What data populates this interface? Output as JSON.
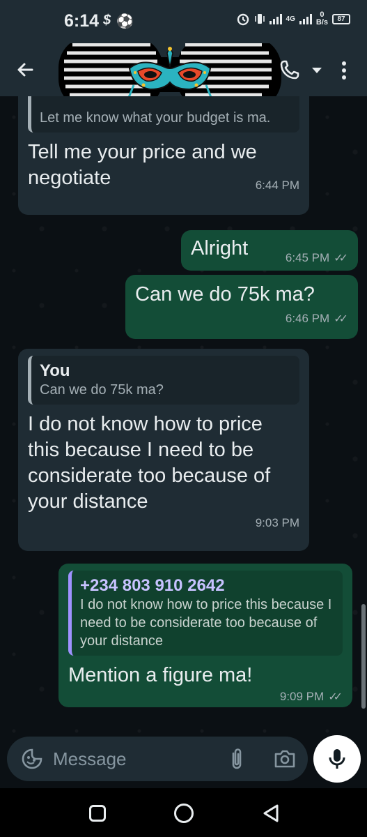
{
  "status_bar": {
    "time": "6:14",
    "left_icons": [
      "s-icon",
      "soccer-icon"
    ],
    "network_type": "4G",
    "net_speed_value": "0",
    "net_speed_unit": "B/s",
    "battery": "87"
  },
  "header": {
    "icons": [
      "back-arrow-icon",
      "phone-icon",
      "chevron-down-icon",
      "more-vert-icon"
    ]
  },
  "messages": [
    {
      "type": "incoming",
      "quote_text": "Let me know what your budget is ma.",
      "text": "Tell me your price and we negotiate",
      "time": "6:44 PM"
    },
    {
      "type": "outgoing",
      "text": "Alright",
      "time": "6:45 PM"
    },
    {
      "type": "outgoing",
      "text": "Can we do 75k ma?",
      "time": "6:46 PM"
    },
    {
      "type": "incoming",
      "quote_author": "You",
      "quote_text": "Can we do 75k ma?",
      "text": "I do not know how to price this because I need to be considerate too because of your distance",
      "time": "9:03 PM"
    },
    {
      "type": "outgoing",
      "quote_author": "+234 803 910 2642",
      "quote_text": "I do not know how to price this because I need to be considerate too because of your distance",
      "text": "Mention a figure ma!",
      "time": "9:09 PM"
    }
  ],
  "composer": {
    "placeholder": "Message"
  },
  "colors": {
    "header_bg": "#1f2c34",
    "chat_bg": "#0b1014",
    "incoming_bubble": "#1f2c34",
    "outgoing_bubble": "#134d37",
    "meta_text": "#a5b0b6",
    "quote_author_purple": "#c7c2ff"
  }
}
